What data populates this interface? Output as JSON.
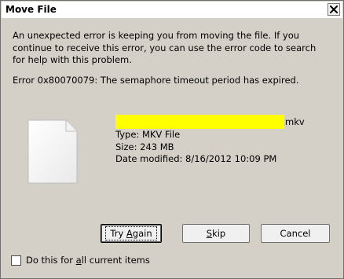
{
  "dialog": {
    "title": "Move File",
    "close_icon": "close-icon",
    "message": "An unexpected error is keeping you from moving the file. If you continue to receive this error, you can use the error code to search for help with this problem.",
    "error_line": "Error 0x80070079: The semaphore timeout period has expired."
  },
  "file": {
    "icon": "file-icon",
    "name_suffix": "mkv",
    "redaction_color": "#ffff00",
    "type": "Type: MKV File",
    "size": "Size: 243 MB",
    "date_modified": "Date modified: 8/16/2012 10:09 PM"
  },
  "buttons": {
    "try_again_pre": "Try ",
    "try_again_access": "A",
    "try_again_post": "gain",
    "skip_access": "S",
    "skip_post": "kip",
    "cancel": "Cancel"
  },
  "checkbox": {
    "label_pre": "Do this for ",
    "label_access": "a",
    "label_post": "ll current items",
    "checked": false
  }
}
